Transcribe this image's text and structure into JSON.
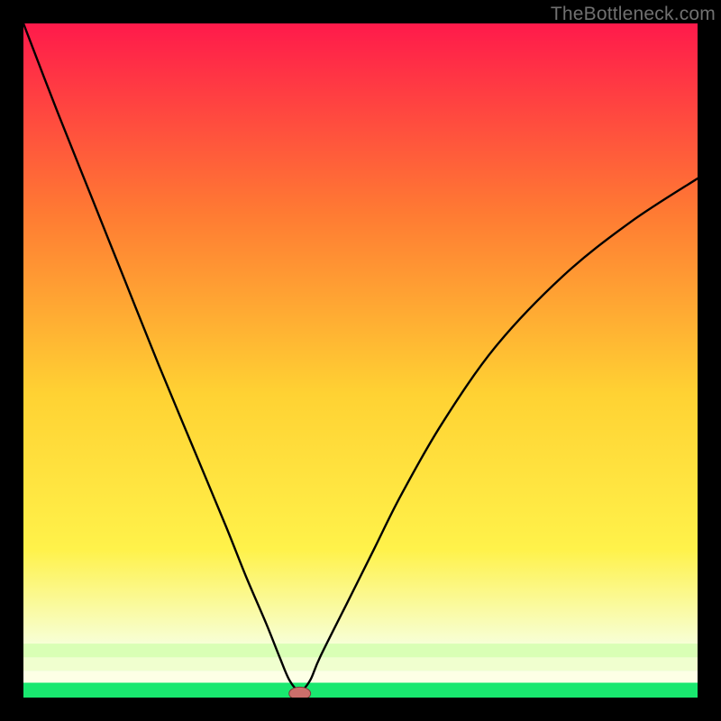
{
  "watermark": "TheBottleneck.com",
  "colors": {
    "gradient_top": "#ff1a4b",
    "gradient_upper_mid": "#ff7a33",
    "gradient_mid": "#ffd233",
    "gradient_lower_mid": "#fff24a",
    "gradient_pale": "#f7ffd6",
    "gradient_bottom": "#19e86f",
    "curve": "#000000",
    "marker_fill": "#cc6f6b",
    "marker_stroke": "#7a3a38",
    "frame_bg": "#000000"
  },
  "chart_data": {
    "type": "line",
    "title": "",
    "xlabel": "",
    "ylabel": "",
    "xlim": [
      0,
      100
    ],
    "ylim": [
      0,
      100
    ],
    "grid": false,
    "legend": false,
    "series": [
      {
        "name": "bottleneck-curve",
        "x": [
          0,
          5,
          10,
          15,
          20,
          25,
          30,
          33,
          36,
          38,
          39.5,
          41,
          42.5,
          44,
          48,
          52,
          56,
          62,
          70,
          80,
          90,
          100
        ],
        "y": [
          100,
          87,
          74.5,
          62,
          49.5,
          37.5,
          25.5,
          18,
          11,
          6,
          2.5,
          1,
          2.5,
          6,
          14,
          22,
          30,
          40.5,
          52,
          62.5,
          70.5,
          77
        ]
      }
    ],
    "marker": {
      "x": 41,
      "y": 0.6,
      "rx": 1.6,
      "ry": 0.95
    },
    "green_band_y": [
      0,
      2.2
    ],
    "pale_bands_y": [
      [
        2.2,
        4.0
      ],
      [
        4.0,
        6.0
      ],
      [
        6.0,
        8.0
      ]
    ]
  }
}
